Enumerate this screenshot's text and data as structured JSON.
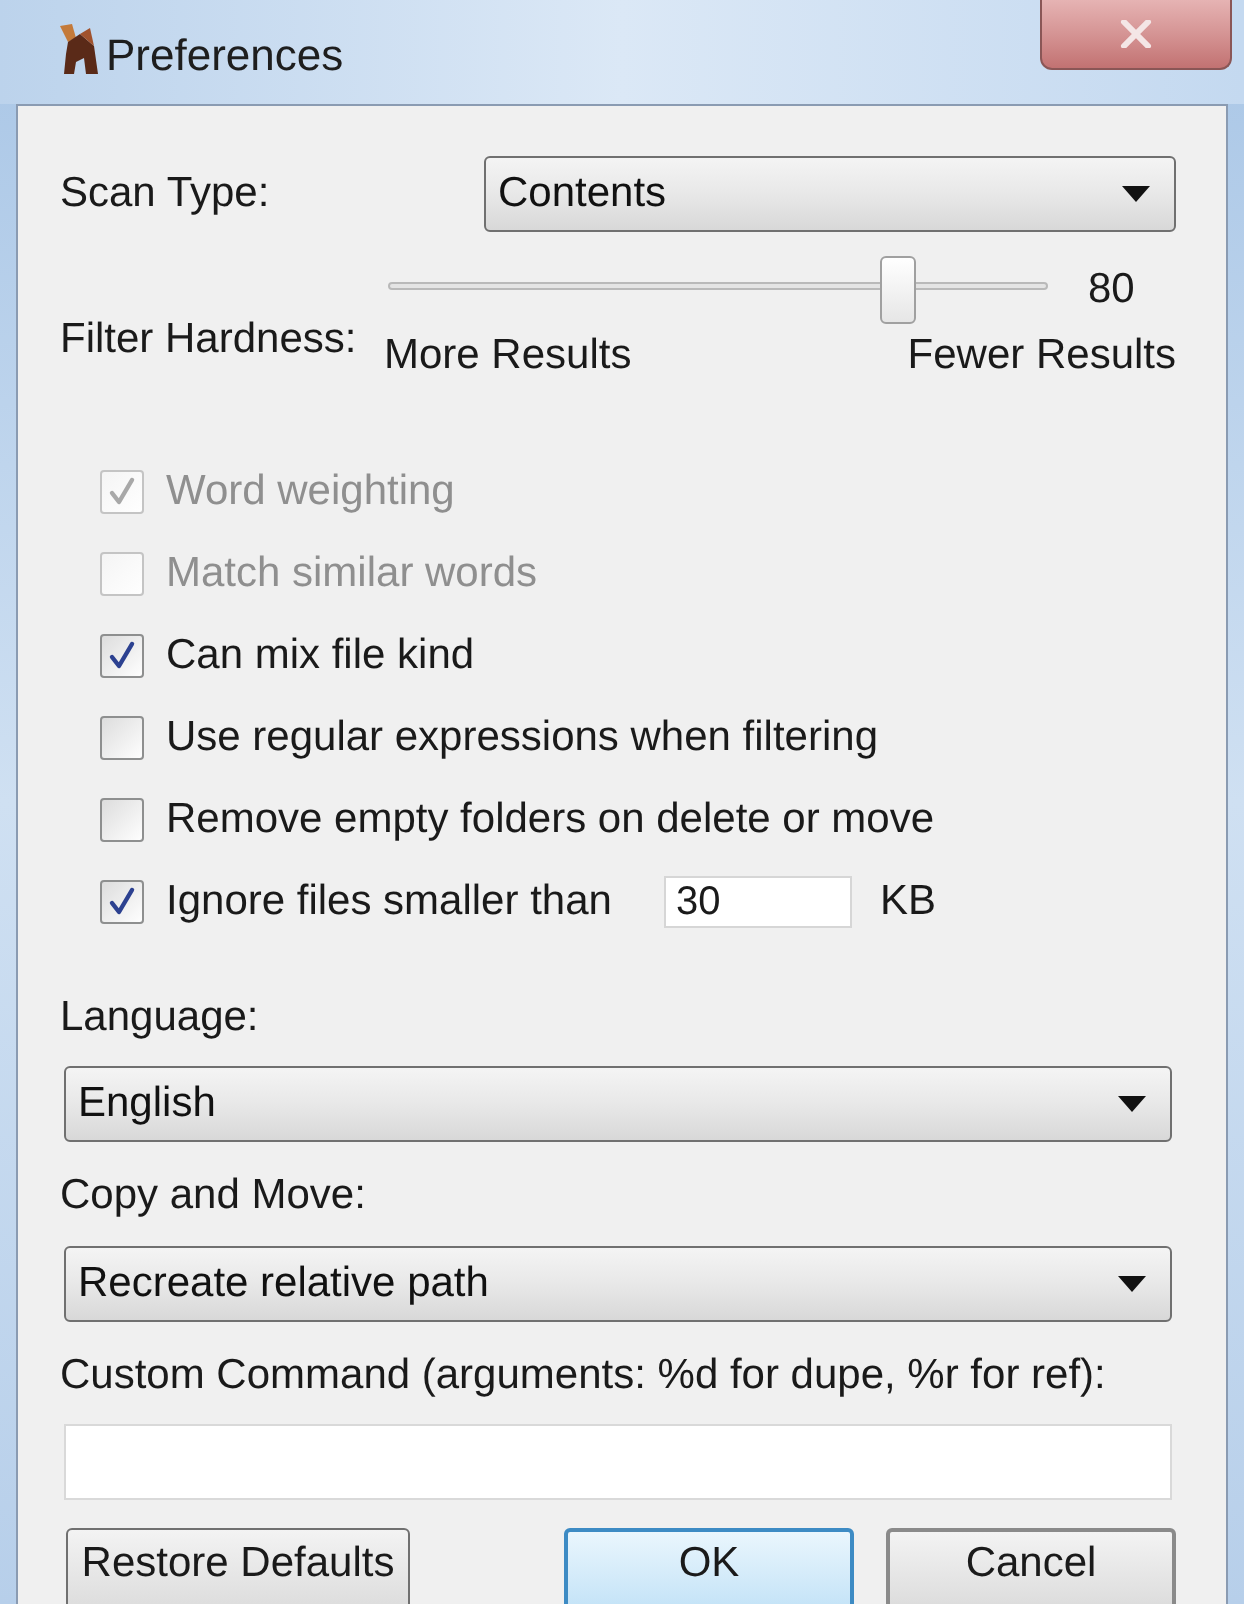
{
  "window": {
    "title": "Preferences"
  },
  "scan_type": {
    "label": "Scan Type:",
    "value": "Contents"
  },
  "filter_hardness": {
    "label": "Filter Hardness:",
    "level": 0.79,
    "reading": "80",
    "min_label": "More Results",
    "max_label": "Fewer Results"
  },
  "options": [
    {
      "label": "Word weighting",
      "checked": true,
      "disabled": true
    },
    {
      "label": "Match similar words",
      "checked": false,
      "disabled": true
    },
    {
      "label": "Can mix file kind",
      "checked": true,
      "disabled": false
    },
    {
      "label": "Use regular expressions when filtering",
      "checked": false,
      "disabled": false
    },
    {
      "label": "Remove empty folders on delete or move",
      "checked": false,
      "disabled": false
    },
    {
      "label": "Ignore files smaller than",
      "checked": true,
      "disabled": false,
      "field": {
        "value": "30"
      },
      "unit": "KB"
    }
  ],
  "language": {
    "label": "Language:",
    "value": "English"
  },
  "copy_and_move": {
    "label": "Copy and Move:",
    "value": "Recreate relative path"
  },
  "custom_command": {
    "label": "Custom Command (arguments: %d for dupe, %r for ref):"
  },
  "footer": {
    "left_buttons": [
      {
        "label": "Restore Defaults",
        "default": false
      }
    ],
    "right_buttons": [
      {
        "label": "OK",
        "default": true
      },
      {
        "label": "Cancel",
        "default": false
      }
    ]
  }
}
